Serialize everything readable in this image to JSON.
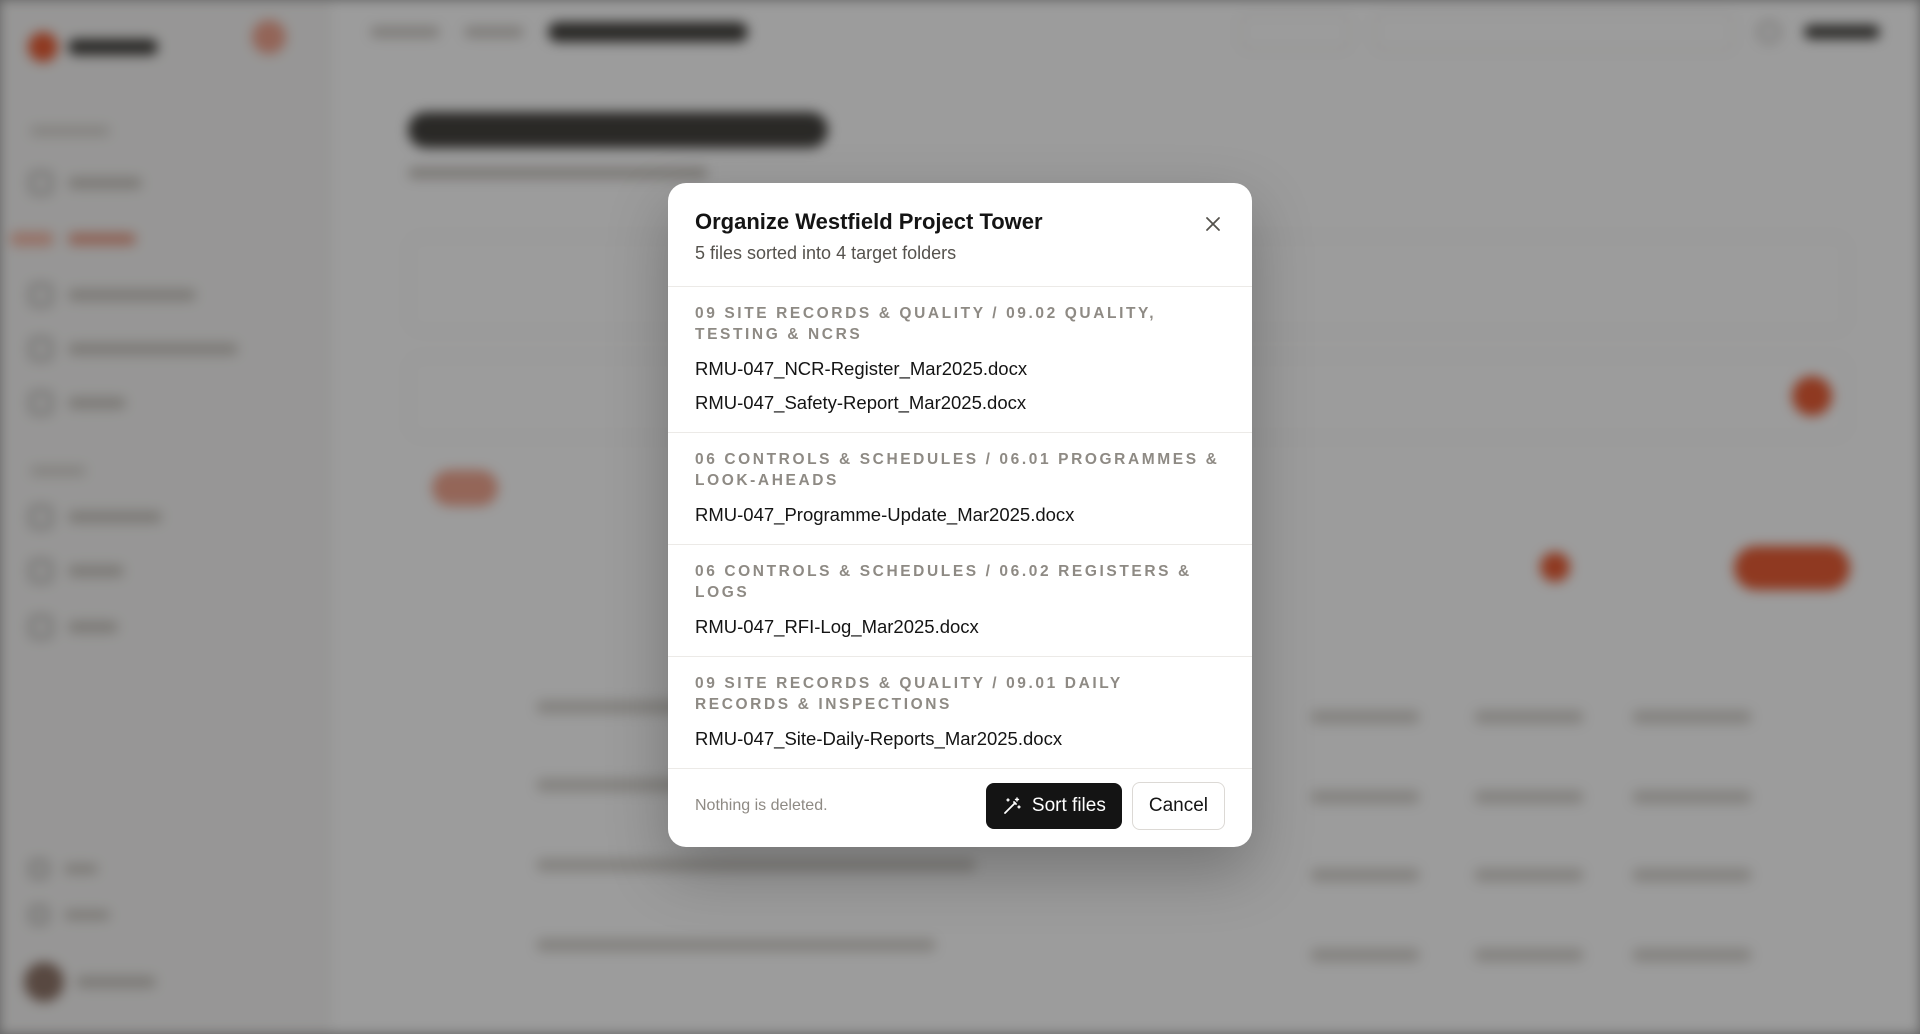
{
  "modal": {
    "title": "Organize Westfield Project Tower",
    "subtitle": "5 files sorted into 4 target folders",
    "groups": [
      {
        "folder": "09 Site Records & Quality / 09.02 Quality, Testing & NCRs",
        "files": [
          "RMU-047_NCR-Register_Mar2025.docx",
          "RMU-047_Safety-Report_Mar2025.docx"
        ]
      },
      {
        "folder": "06 Controls & Schedules / 06.01 Programmes & Look-aheads",
        "files": [
          "RMU-047_Programme-Update_Mar2025.docx"
        ]
      },
      {
        "folder": "06 Controls & Schedules / 06.02 Registers & Logs",
        "files": [
          "RMU-047_RFI-Log_Mar2025.docx"
        ]
      },
      {
        "folder": "09 Site Records & Quality / 09.01 Daily Records & Inspections",
        "files": [
          "RMU-047_Site-Daily-Reports_Mar2025.docx"
        ]
      }
    ],
    "footer_note": "Nothing is deleted.",
    "primary_label": "Sort files",
    "secondary_label": "Cancel",
    "icons": {
      "close": "close-icon",
      "primary": "magic-wand-icon"
    }
  },
  "colors": {
    "accent": "#e8552b",
    "primary_button": "#141414"
  }
}
